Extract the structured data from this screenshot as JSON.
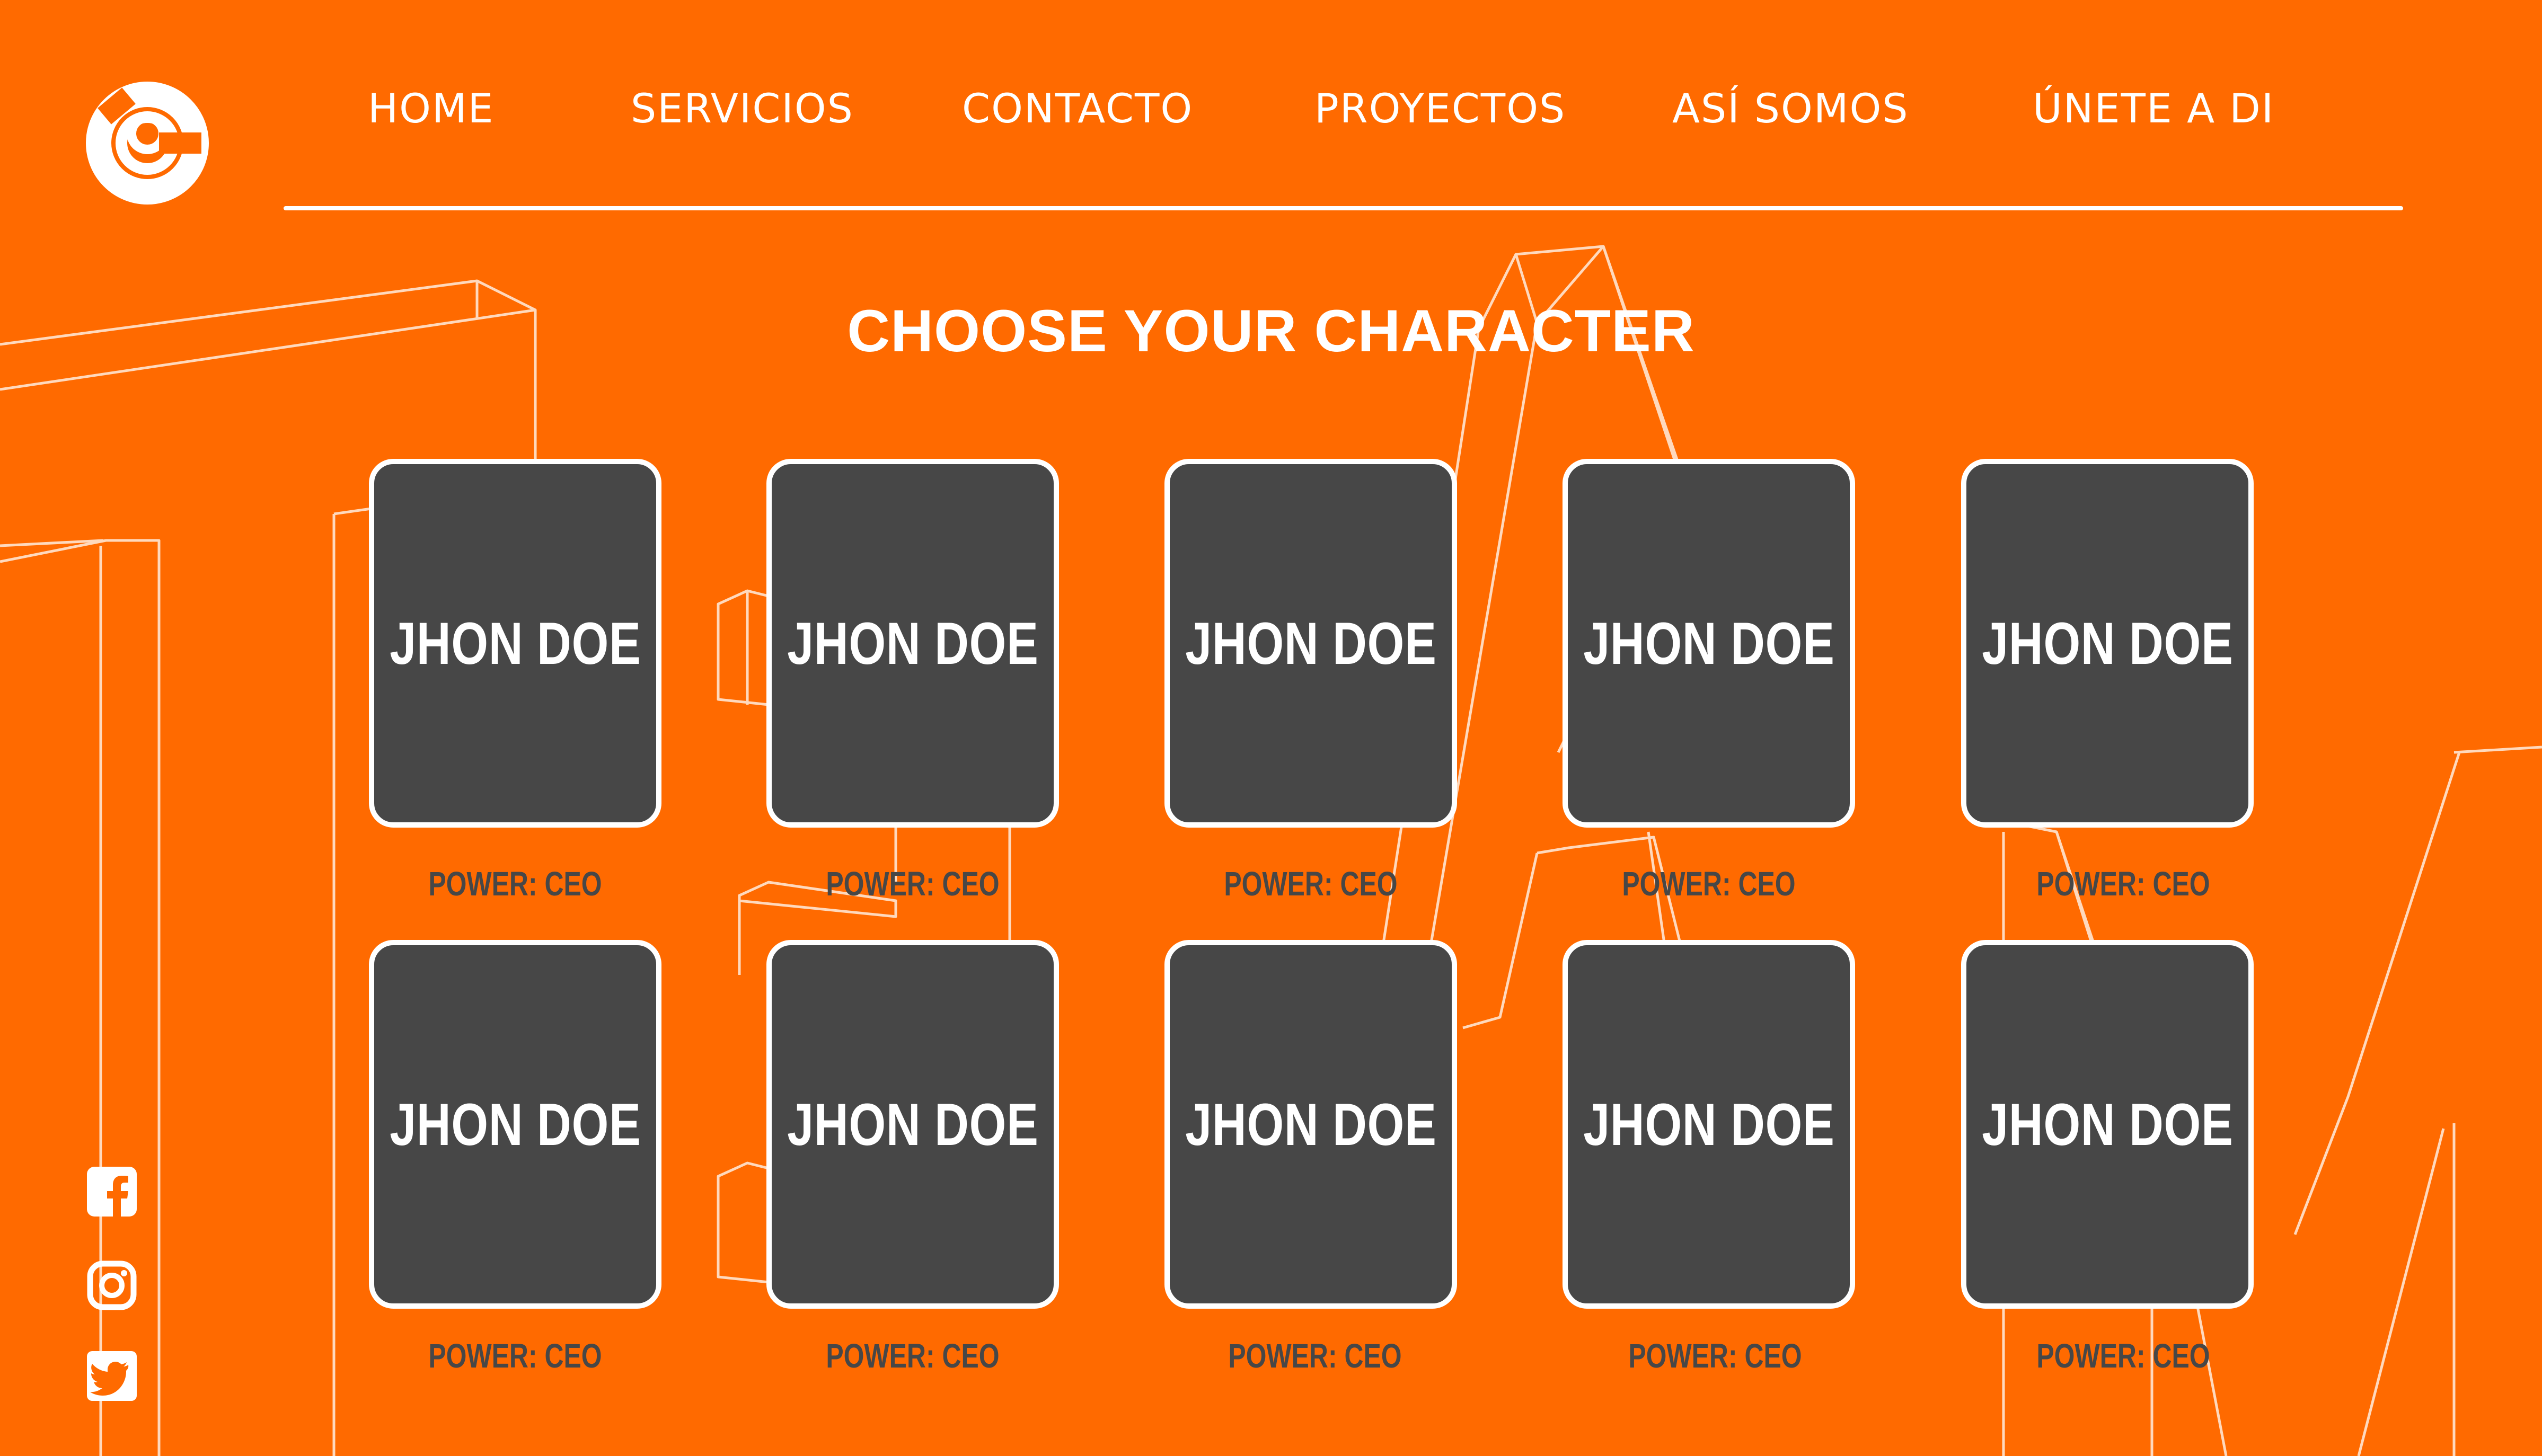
{
  "brand": {
    "logo_icon": "brand-logo-icon"
  },
  "nav": {
    "items": [
      {
        "label": "HOME"
      },
      {
        "label": "SERVICIOS"
      },
      {
        "label": "CONTACTO"
      },
      {
        "label": "PROYECTOS"
      },
      {
        "label": "ASÍ SOMOS"
      },
      {
        "label": "ÚNETE A DI"
      }
    ]
  },
  "main": {
    "title": "CHOOSE YOUR CHARACTER",
    "characters": [
      {
        "name": "JHON DOE",
        "power": "POWER: CEO"
      },
      {
        "name": "JHON DOE",
        "power": "POWER: CEO"
      },
      {
        "name": "JHON DOE",
        "power": "POWER: CEO"
      },
      {
        "name": "JHON DOE",
        "power": "POWER: CEO"
      },
      {
        "name": "JHON DOE",
        "power": "POWER: CEO"
      },
      {
        "name": "JHON DOE",
        "power": "POWER: CEO"
      },
      {
        "name": "JHON DOE",
        "power": "POWER: CEO"
      },
      {
        "name": "JHON DOE",
        "power": "POWER: CEO"
      },
      {
        "name": "JHON DOE",
        "power": "POWER: CEO"
      },
      {
        "name": "JHON DOE",
        "power": "POWER: CEO"
      }
    ]
  },
  "social": {
    "icons": [
      "facebook-icon",
      "instagram-icon",
      "twitter-icon"
    ]
  },
  "colors": {
    "background": "#ff6a00",
    "card": "#474747",
    "text_light": "#ffffff",
    "text_dark": "#474747"
  }
}
